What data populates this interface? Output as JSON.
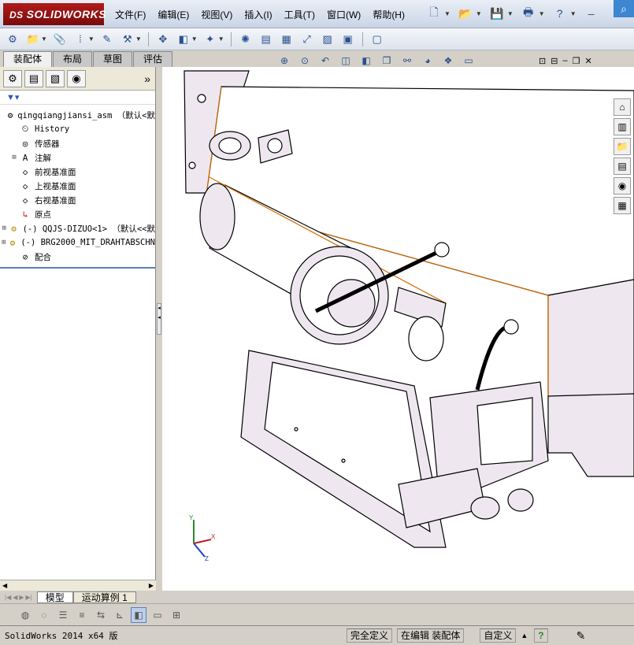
{
  "app": {
    "logo_text": "SOLIDWORKS",
    "logo_prefix": "DS"
  },
  "menu": [
    "文件(F)",
    "编辑(E)",
    "视图(V)",
    "插入(I)",
    "工具(T)",
    "窗口(W)",
    "帮助(H)"
  ],
  "tabs": [
    "装配体",
    "布局",
    "草图",
    "评估"
  ],
  "active_tab": "装配体",
  "tree": {
    "root": "qingqiangjiansi_asm （默认<默",
    "items": [
      {
        "label": "History",
        "icon": "history-icon",
        "expandable": false
      },
      {
        "label": "传感器",
        "icon": "sensor-icon",
        "expandable": false
      },
      {
        "label": "注解",
        "icon": "annotation-icon",
        "expandable": true
      },
      {
        "label": "前视基准面",
        "icon": "plane-icon",
        "expandable": false
      },
      {
        "label": "上视基准面",
        "icon": "plane-icon",
        "expandable": false
      },
      {
        "label": "右视基准面",
        "icon": "plane-icon",
        "expandable": false
      },
      {
        "label": "原点",
        "icon": "origin-icon",
        "expandable": false
      },
      {
        "label": "(-) QQJS-DIZUO<1> （默认<<默",
        "icon": "part-icon",
        "expandable": true
      },
      {
        "label": "(-) BRG2000_MIT_DRAHTABSCHN",
        "icon": "part-icon",
        "expandable": true
      },
      {
        "label": "配合",
        "icon": "mates-icon",
        "expandable": false
      }
    ]
  },
  "bottom_tabs": [
    "模型",
    "运动算例 1"
  ],
  "status": {
    "main": "SolidWorks 2014 x64 版",
    "under_defined": "完全定义",
    "editing": "在编辑 装配体",
    "custom": "自定义",
    "help": "?"
  },
  "triad": {
    "x": "X",
    "y": "Y",
    "z": "Z"
  }
}
